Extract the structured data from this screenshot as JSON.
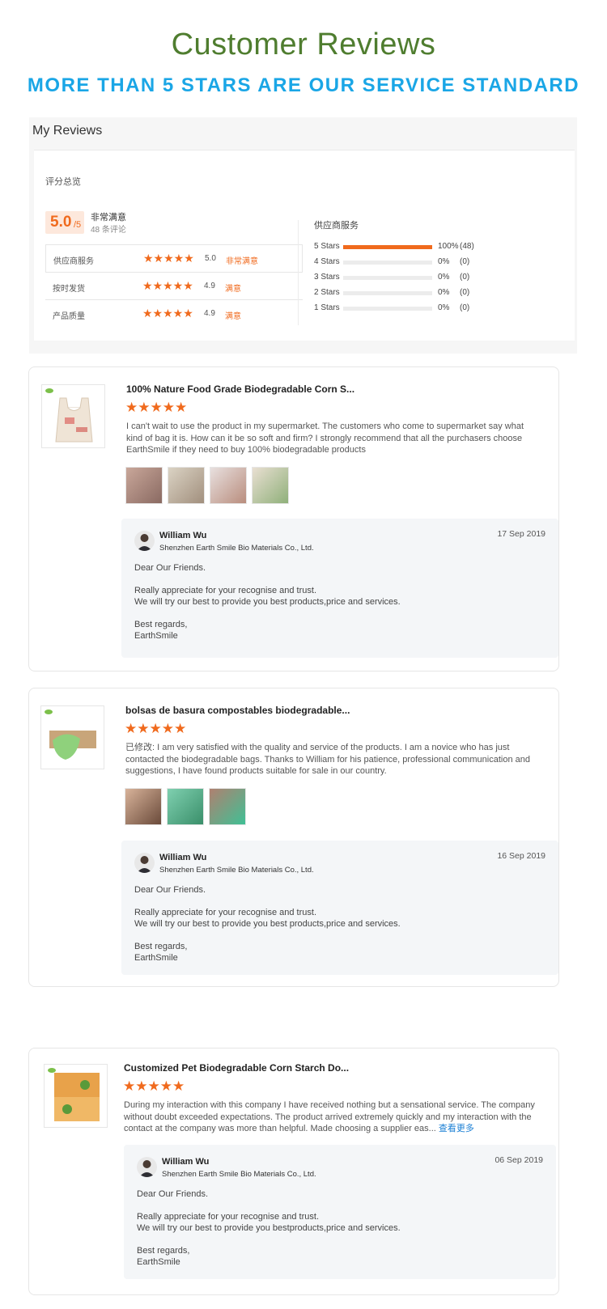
{
  "header": {
    "title": "Customer Reviews",
    "subtitle": "MORE THAN 5 STARS ARE OUR SERVICE STANDARD"
  },
  "my_reviews": {
    "title": "My Reviews",
    "summary_label": "评分总览",
    "score": "5.0",
    "score_max": "/5",
    "overall_text": "非常满意",
    "review_count": "48 条评论",
    "ratings": [
      {
        "label": "供应商服务",
        "stars": "★★★★★",
        "score": "5.0",
        "text": "非常满意"
      },
      {
        "label": "按时发货",
        "stars": "★★★★★",
        "score": "4.9",
        "text": "满意"
      },
      {
        "label": "产品质量",
        "stars": "★★★★★",
        "score": "4.9",
        "text": "满意"
      }
    ],
    "distribution_title": "供应商服务",
    "distribution": [
      {
        "label": "5 Stars",
        "fraction": 1.0,
        "pct": "100%",
        "count": "(48)"
      },
      {
        "label": "4 Stars",
        "fraction": 0,
        "pct": "0%",
        "count": "(0)"
      },
      {
        "label": "3 Stars",
        "fraction": 0,
        "pct": "0%",
        "count": "(0)"
      },
      {
        "label": "2 Stars",
        "fraction": 0,
        "pct": "0%",
        "count": "(0)"
      },
      {
        "label": "1 Stars",
        "fraction": 0,
        "pct": "0%",
        "count": "(0)"
      }
    ],
    "accent_color": "#f06a1d"
  },
  "reviews": [
    {
      "product_title": "100% Nature Food Grade Biodegradable Corn S...",
      "stars": "★★★★★",
      "text": "I can't wait to use the product in my supermarket. The customers who come to  supermarket say what kind of bag it is. How can it be so soft and firm? I strongly recommend that all the purchasers choose EarthSmile if they need to buy 100% biodegradable products",
      "more": "",
      "reply": {
        "name": "William Wu",
        "company": "Shenzhen Earth Smile Bio Materials Co., Ltd.",
        "date": "17 Sep 2019",
        "greeting": "Dear Our Friends.",
        "line1": "Really appreciate for your recognise and trust.",
        "line2": "We will try our best to provide you best products,price and services.",
        "closing": "Best regards,",
        "signature": "EarthSmile"
      }
    },
    {
      "product_title": "bolsas de basura compostables biodegradable...",
      "stars": "★★★★★",
      "text": "已修改: I am very satisfied with the quality and service of the products. I am a novice who has just contacted the biodegradable bags. Thanks to William for his patience, professional communication and suggestions, I have found products suitable for sale in our country.",
      "more": "",
      "reply": {
        "name": "William Wu",
        "company": "Shenzhen Earth Smile Bio Materials Co., Ltd.",
        "date": "16 Sep 2019",
        "greeting": "Dear Our Friends.",
        "line1": "Really appreciate for your recognise and trust.",
        "line2": "We will try our best to provide you best products,price and services.",
        "closing": "Best regards,",
        "signature": "EarthSmile"
      }
    },
    {
      "product_title": "Customized Pet Biodegradable Corn Starch Do...",
      "stars": "★★★★★",
      "text": "During my interaction with this company I have received nothing but a sensational service. The company without doubt exceeded expectations. The product arrived extremely quickly and my interaction with the contact at the company was more than helpful. Made choosing a supplier eas... ",
      "more": "查看更多",
      "reply": {
        "name": "William Wu",
        "company": "Shenzhen Earth Smile Bio Materials Co., Ltd.",
        "date": "06 Sep 2019",
        "greeting": "Dear Our Friends.",
        "line1": "Really appreciate for your recognise and trust.",
        "line2": "We will try our best to provide you bestproducts,price and services.",
        "closing": "Best regards,",
        "signature": "EarthSmile"
      }
    }
  ]
}
